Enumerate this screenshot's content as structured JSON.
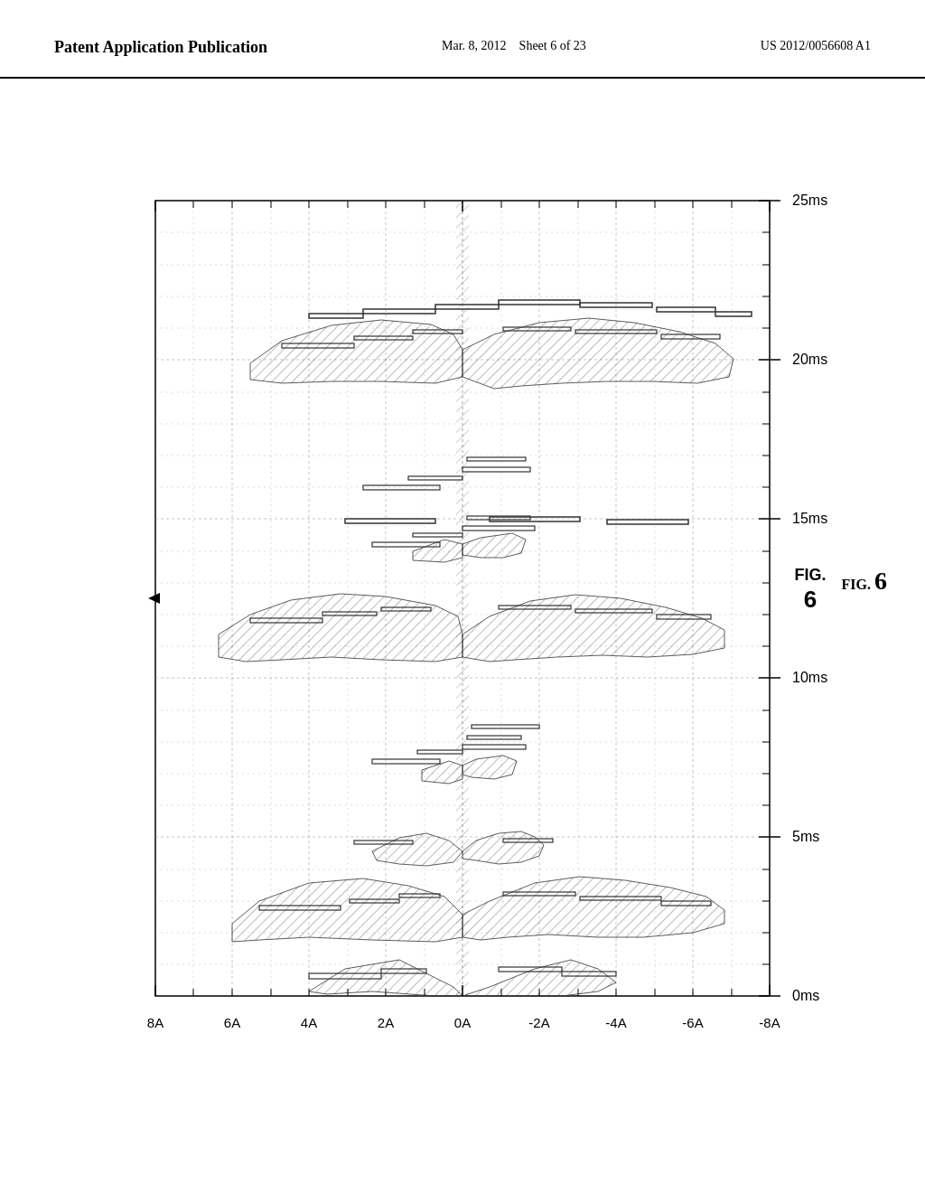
{
  "header": {
    "left_label": "Patent Application Publication",
    "center_date": "Mar. 8, 2012",
    "center_sheet": "Sheet 6 of 23",
    "right_patent": "US 2012/0056608 A1"
  },
  "chart": {
    "title": "FIG. 6",
    "x_axis_labels": [
      "8A",
      "6A",
      "4A",
      "2A",
      "0A",
      "-2A",
      "-4A",
      "-6A",
      "-8A"
    ],
    "y_axis_labels": [
      "0ms",
      "5ms",
      "10ms",
      "15ms",
      "20ms",
      "25ms"
    ]
  }
}
